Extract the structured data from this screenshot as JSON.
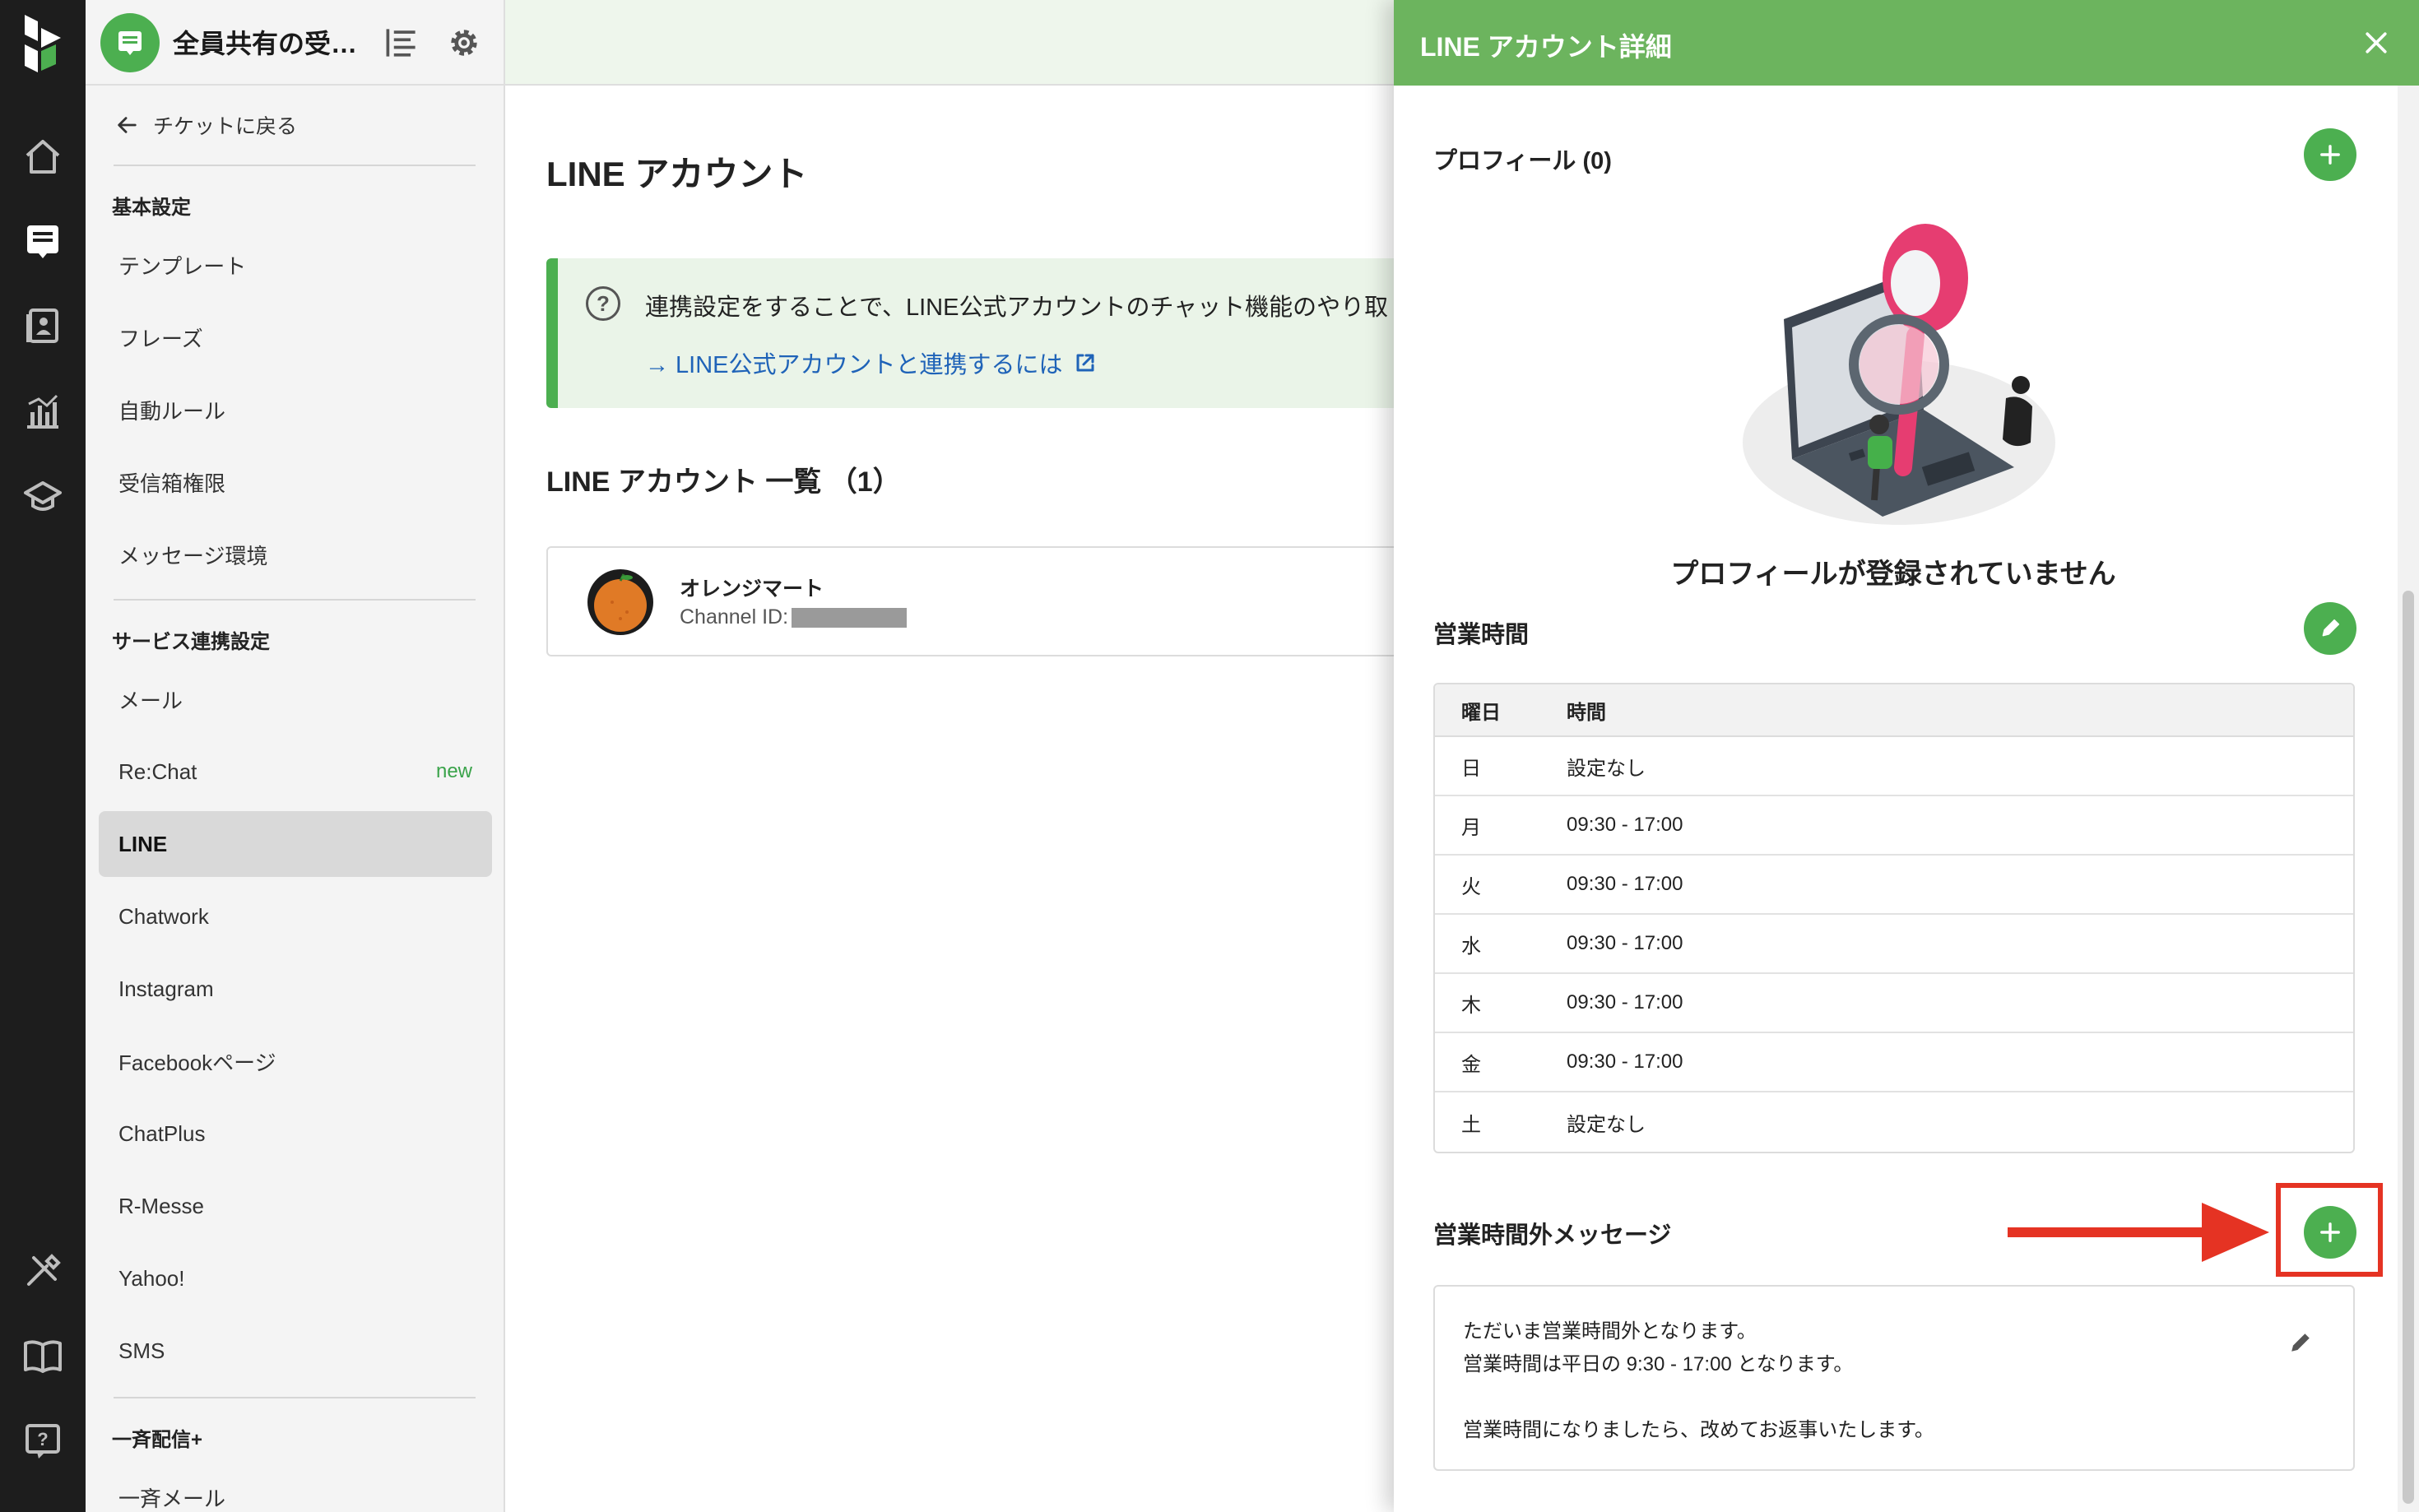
{
  "topbar": {
    "inbox_title": "全員共有の受…"
  },
  "sidebar": {
    "back_label": "チケットに戻る",
    "basic_heading": "基本設定",
    "basic_items": [
      "テンプレート",
      "フレーズ",
      "自動ルール",
      "受信箱権限",
      "メッセージ環境"
    ],
    "service_heading": "サービス連携設定",
    "service_items": [
      "メール",
      "Re:Chat",
      "LINE",
      "Chatwork",
      "Instagram",
      "Facebookページ",
      "ChatPlus",
      "R-Messe",
      "Yahoo!",
      "SMS"
    ],
    "new_badge": "new",
    "active_item": "LINE",
    "broadcast_heading": "一斉配信+",
    "broadcast_items": [
      "一斉メール"
    ]
  },
  "main": {
    "title": "LINE アカウント",
    "info_text": "連携設定をすることで、LINE公式アカウントのチャット機能のやり取",
    "info_link": "→ LINE公式アカウントと連携するには",
    "list_title": "LINE アカウント 一覧 （1）",
    "account": {
      "name": "オレンジマート",
      "channel_label": "Channel ID:"
    }
  },
  "drawer": {
    "title": "LINE アカウント詳細",
    "profile_title": "プロフィール (0)",
    "empty_label": "プロフィールが登録されていません",
    "hours_title": "営業時間",
    "hours_header": {
      "day": "曜日",
      "time": "時間"
    },
    "hours": [
      {
        "day": "日",
        "time": "設定なし"
      },
      {
        "day": "月",
        "time": "09:30 - 17:00"
      },
      {
        "day": "火",
        "time": "09:30 - 17:00"
      },
      {
        "day": "水",
        "time": "09:30 - 17:00"
      },
      {
        "day": "木",
        "time": "09:30 - 17:00"
      },
      {
        "day": "金",
        "time": "09:30 - 17:00"
      },
      {
        "day": "土",
        "time": "設定なし"
      }
    ],
    "after_hours_title": "営業時間外メッセージ",
    "after_hours_message": {
      "line1": "ただいま営業時間外となります。",
      "line2": "営業時間は平日の 9:30 - 17:00 となります。",
      "line3": "営業時間になりましたら、改めてお返事いたします。"
    }
  },
  "colors": {
    "brand_green": "#4caf50",
    "header_green": "#6cb45e",
    "link_blue": "#1f63b8",
    "annotation_red": "#e53323"
  },
  "icons": [
    "logo-icon",
    "home-icon",
    "inbox-icon",
    "contacts-icon",
    "analytics-icon",
    "academy-icon",
    "tools-icon",
    "guide-icon",
    "help-icon",
    "filter-icon",
    "gear-icon",
    "close-icon",
    "plus-icon",
    "pencil-icon",
    "external-link-icon",
    "back-arrow-icon"
  ]
}
